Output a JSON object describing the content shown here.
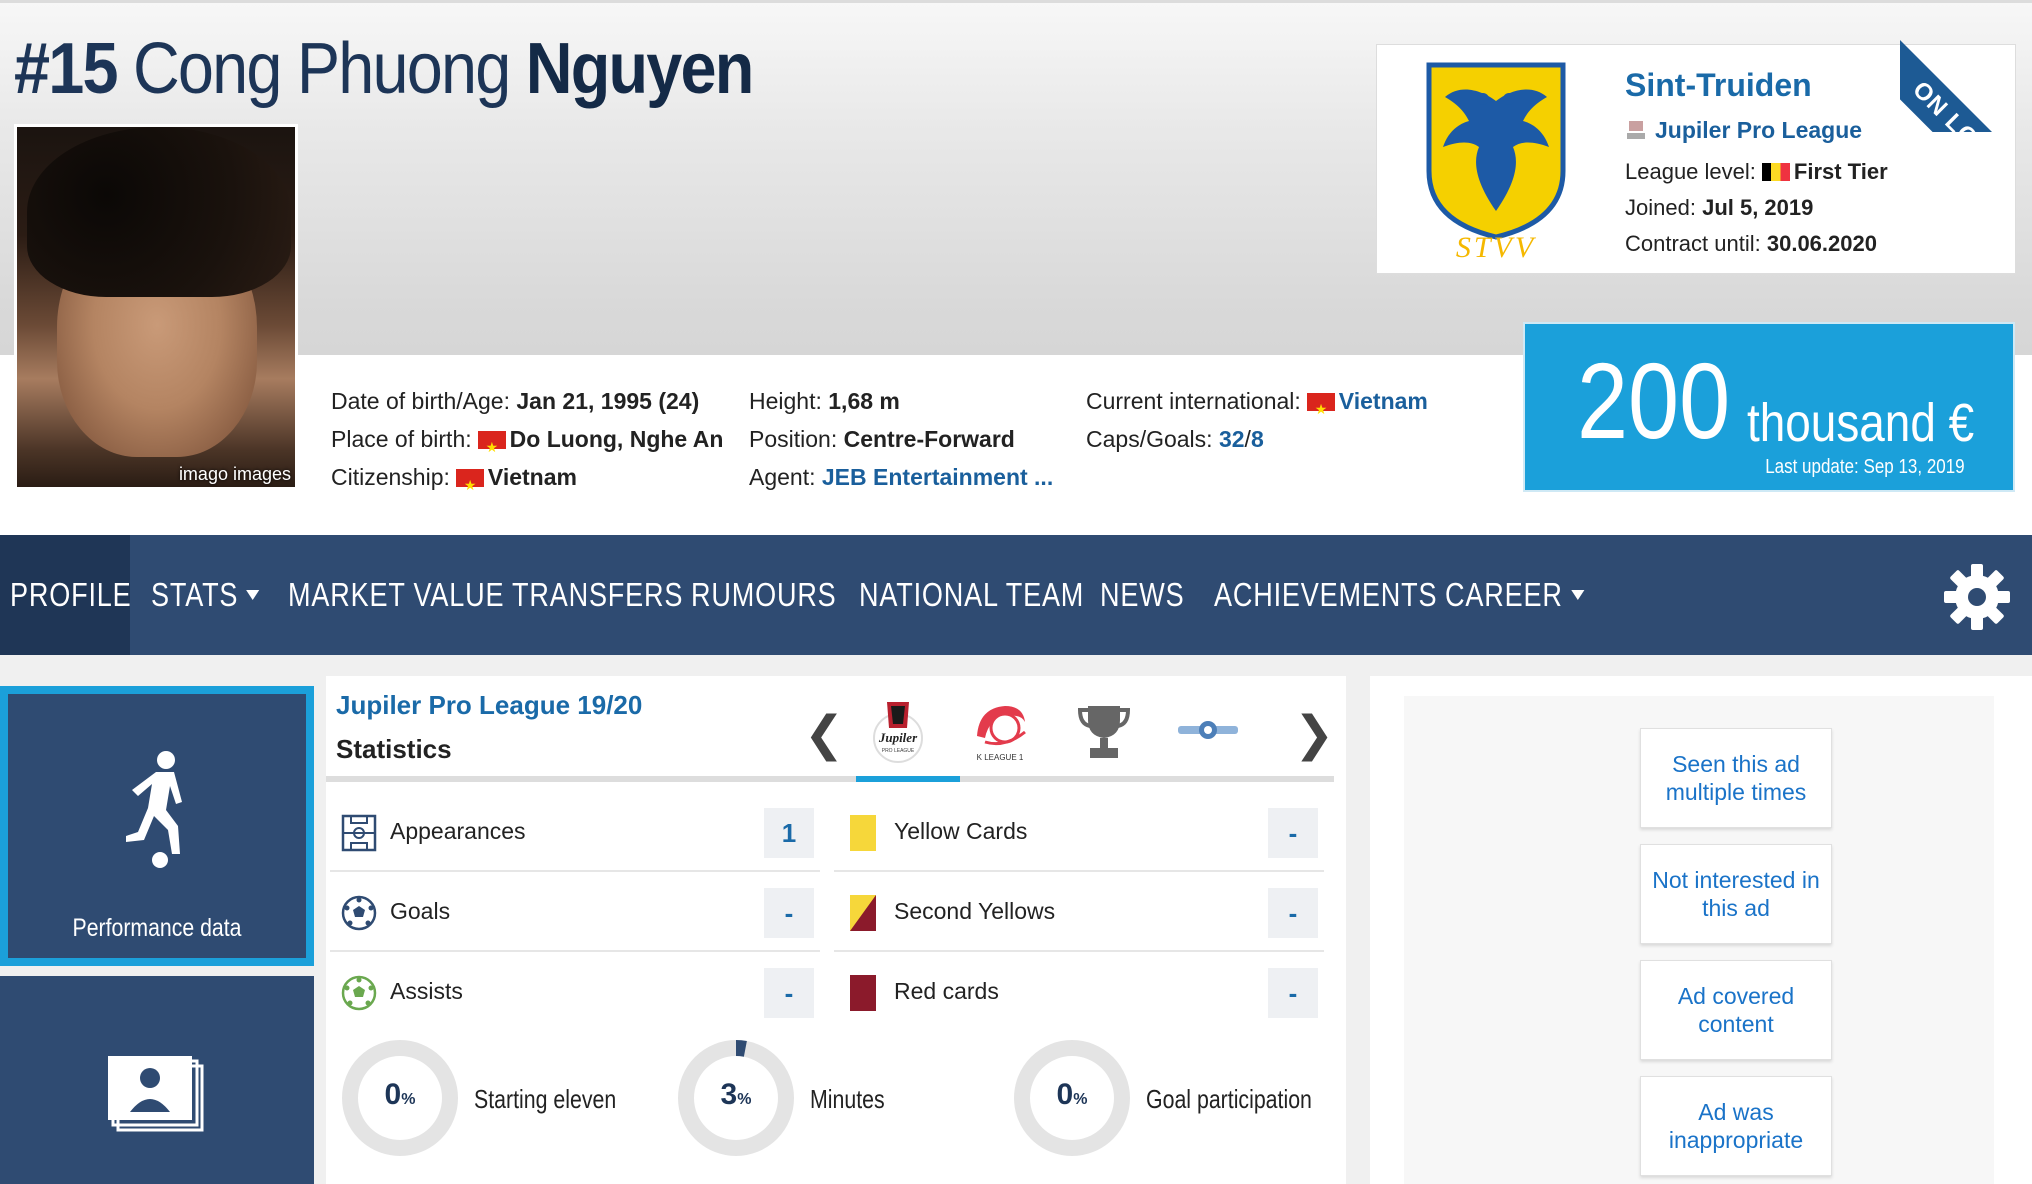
{
  "player": {
    "number": "#15",
    "first_name": "Cong Phuong",
    "last_name": "Nguyen",
    "photo_credit": "imago images"
  },
  "info": {
    "col1": [
      {
        "label": "Date of birth/Age:",
        "value": "Jan 21, 1995 (24)"
      },
      {
        "label": "Place of birth:",
        "value": "Do Luong, Nghe An"
      },
      {
        "label": "Citizenship:",
        "value": "Vietnam"
      }
    ],
    "col2": [
      {
        "label": "Height:",
        "value": "1,68 m"
      },
      {
        "label": "Position:",
        "value": "Centre-Forward"
      },
      {
        "label": "Agent:",
        "value": "JEB Entertainment ..."
      }
    ],
    "col3": [
      {
        "label": "Current international:",
        "value": "Vietnam"
      },
      {
        "label": "Caps/Goals:",
        "caps": "32",
        "sep": "/",
        "goals": "8"
      }
    ]
  },
  "club": {
    "name": "Sint-Truiden",
    "league": "Jupiler Pro League",
    "level_label": "League level:",
    "level_value": "First Tier",
    "joined_label": "Joined:",
    "joined_value": "Jul 5, 2019",
    "contract_label": "Contract until:",
    "contract_value": "30.06.2020",
    "crest_text": "STVV",
    "loan_badge": "ON LOAN"
  },
  "market_value": {
    "amount": "200",
    "unit": "thousand €",
    "update": "Last update: Sep 13, 2019"
  },
  "nav": {
    "items": [
      "PROFILE",
      "STATS",
      "MARKET VALUE",
      "TRANSFERS",
      "RUMOURS",
      "NATIONAL TEAM",
      "NEWS",
      "ACHIEVEMENTS",
      "CAREER"
    ]
  },
  "side": {
    "performance_label": "Performance data"
  },
  "stats": {
    "competition": "Jupiler Pro League 19/20",
    "subtitle": "Statistics",
    "prev": "❮",
    "next": "❯",
    "logo_jupiler": "Jupiler",
    "logo_jupiler_sub": "PRO LEAGUE",
    "logo_kleague": "K LEAGUE 1",
    "left": [
      {
        "label": "Appearances",
        "value": "1"
      },
      {
        "label": "Goals",
        "value": "-"
      },
      {
        "label": "Assists",
        "value": "-"
      }
    ],
    "right": [
      {
        "label": "Yellow Cards",
        "value": "-"
      },
      {
        "label": "Second Yellows",
        "value": "-"
      },
      {
        "label": "Red cards",
        "value": "-"
      }
    ],
    "donuts": [
      {
        "value": "0",
        "unit": "%",
        "label": "Starting eleven",
        "fraction": 0
      },
      {
        "value": "3",
        "unit": "%",
        "label": "Minutes",
        "fraction": 0.03
      },
      {
        "value": "0",
        "unit": "%",
        "label": "Goal participation",
        "fraction": 0
      }
    ]
  },
  "ads": {
    "buttons": [
      "Seen this ad multiple times",
      "Not interested in this ad",
      "Ad covered content",
      "Ad was inappropriate"
    ]
  },
  "colors": {
    "nav": "#2f4b72",
    "accent": "#1ba0da",
    "link": "#1a5f9c",
    "yellow_card": "#f6d73a",
    "red_card": "#8b1a2b"
  }
}
